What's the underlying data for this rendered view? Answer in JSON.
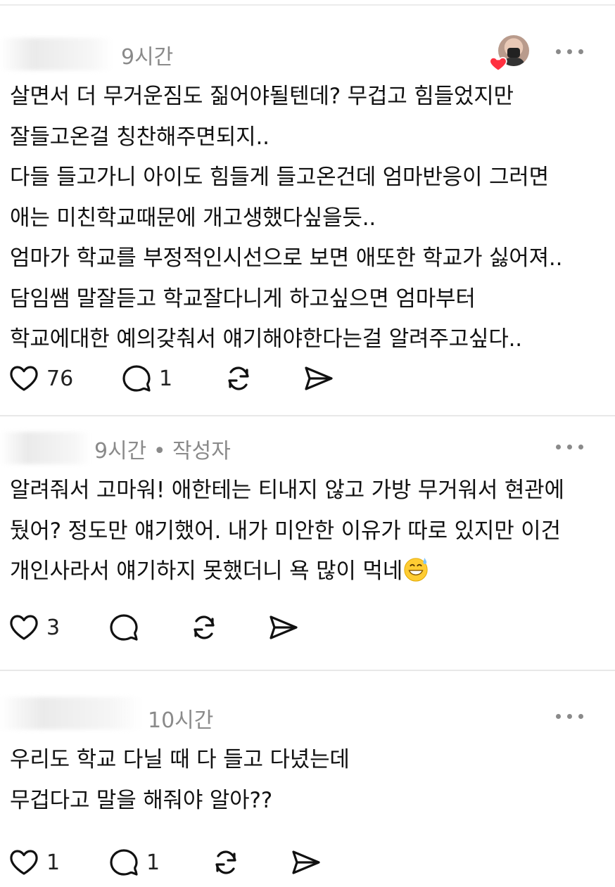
{
  "posts": [
    {
      "username": "",
      "meta": "9시간",
      "lines": [
        "살면서 더 무거운짐도 짊어야될텐데? 무겁고 힘들었지만",
        "잘들고온걸 칭찬해주면되지..",
        "다들 들고가니 아이도 힘들게 들고온건데 엄마반응이 그러면",
        "애는 미친학교때문에 개고생했다싶을듯..",
        "엄마가 학교를 부정적인시선으로 보면 애또한 학교가 싫어져..",
        "담임쌤 말잘듣고 학교잘다니게 하고싶으면 엄마부터",
        "학교에대한 예의갖춰서 얘기해야한다는걸 알려주고싶다.."
      ],
      "likes": "76",
      "replies": "1"
    },
    {
      "username": "",
      "meta": "9시간 • 작성자",
      "lines": [
        "알려줘서 고마워! 애한테는 티내지 않고 가방 무거워서 현관에",
        "뒀어? 정도만 얘기했어. 내가 미안한 이유가 따로 있지만 이건",
        "개인사라서 얘기하지 못했더니 욕 많이 먹네"
      ],
      "likes": "3",
      "replies": ""
    },
    {
      "username": "",
      "meta": "10시간",
      "lines": [
        "우리도 학교 다닐 때 다 들고 다녔는데",
        "무겁다고 말을 해줘야 알아??"
      ],
      "likes": "1",
      "replies": "1"
    }
  ],
  "icons": {
    "like": "heart-outline-icon",
    "reply": "speech-bubble-icon",
    "repost": "repost-arrows-icon",
    "share": "send-paper-plane-icon",
    "more": "more-dots-icon",
    "emoji": "grinning-sweat-emoji"
  },
  "colors": {
    "text": "#111111",
    "meta": "#8a8a8a",
    "heart_badge": "#ff3040",
    "divider": "#e8e8e8"
  }
}
